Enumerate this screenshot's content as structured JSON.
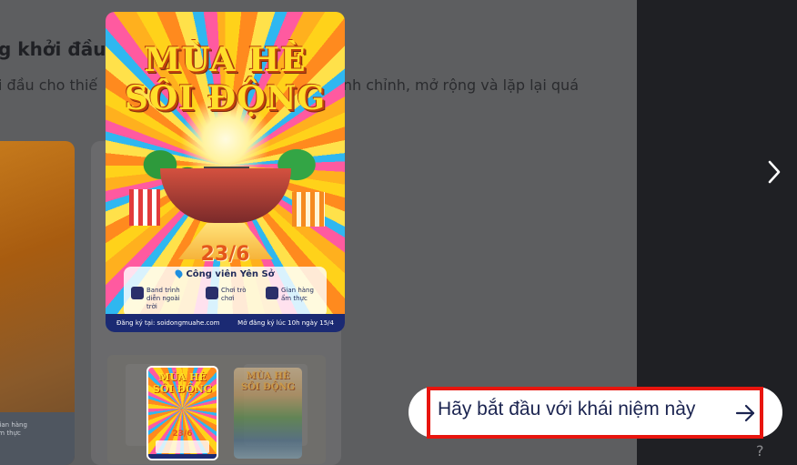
{
  "background_page": {
    "heading": "g khởi đầu",
    "description_left": "i đầu cho thiế",
    "description_right": "nh chỉnh, mở rộng và lặp lại quá",
    "card_left_label": "Gian hàng ẩm thực"
  },
  "poster": {
    "title_line1": "MÙA HÈ",
    "title_line2": "SÔI ĐỘNG",
    "date": "23/6",
    "location": "Công viên Yên Sở",
    "features": [
      {
        "label": "Band trình diễn ngoài trời",
        "icon": "guitar-icon"
      },
      {
        "label": "Chơi trò chơi",
        "icon": "gamepad-icon"
      },
      {
        "label": "Gian hàng ẩm thực",
        "icon": "stall-icon"
      }
    ],
    "footer_left": "Đăng ký tại: soidongmuahe.com",
    "footer_right": "Mở đăng ký lúc 10h ngày 15/4"
  },
  "thumbnails": [
    {
      "title_line1": "MÙA HÈ",
      "title_line2": "SÔI ĐỘNG",
      "date": "23/6",
      "selected": true
    },
    {
      "title_line1": "MÙA HÈ",
      "title_line2": "SÔI ĐỘNG",
      "selected": false
    }
  ],
  "navigation": {
    "next_icon": "chevron-right-icon"
  },
  "cta": {
    "label": "Hãy bắt đầu với khái niệm này",
    "icon": "arrow-right-icon",
    "highlight_color": "#e8150e"
  },
  "help": {
    "label": "?"
  }
}
